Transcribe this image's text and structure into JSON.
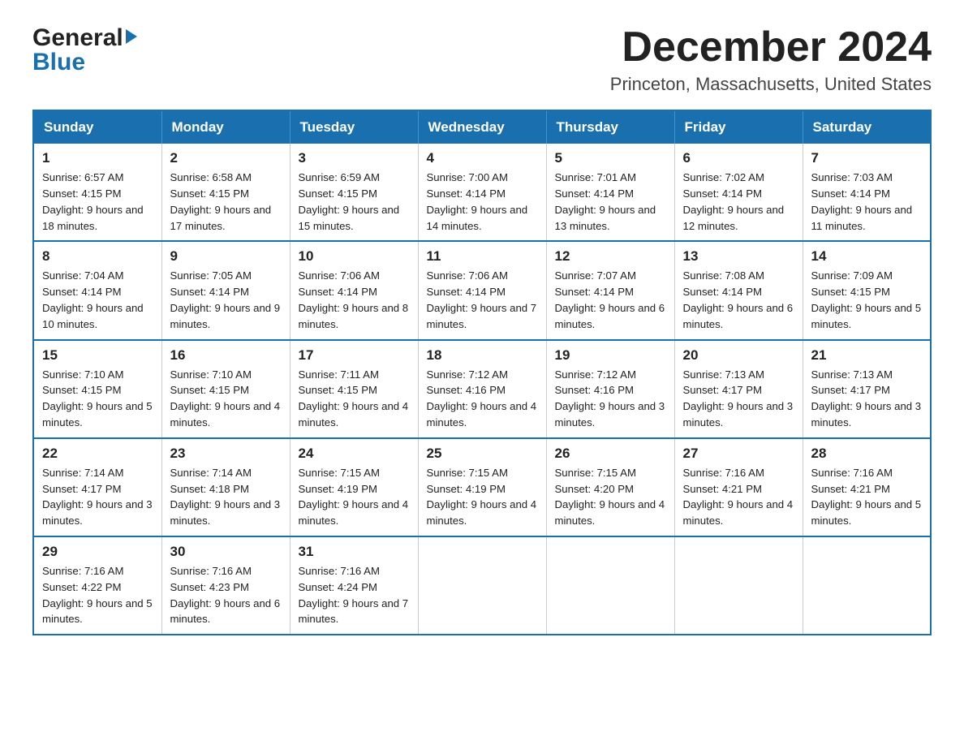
{
  "header": {
    "logo_general": "General",
    "logo_blue": "Blue",
    "month_title": "December 2024",
    "location": "Princeton, Massachusetts, United States"
  },
  "days_of_week": [
    "Sunday",
    "Monday",
    "Tuesday",
    "Wednesday",
    "Thursday",
    "Friday",
    "Saturday"
  ],
  "weeks": [
    [
      {
        "day": "1",
        "sunrise": "6:57 AM",
        "sunset": "4:15 PM",
        "daylight": "9 hours and 18 minutes."
      },
      {
        "day": "2",
        "sunrise": "6:58 AM",
        "sunset": "4:15 PM",
        "daylight": "9 hours and 17 minutes."
      },
      {
        "day": "3",
        "sunrise": "6:59 AM",
        "sunset": "4:15 PM",
        "daylight": "9 hours and 15 minutes."
      },
      {
        "day": "4",
        "sunrise": "7:00 AM",
        "sunset": "4:14 PM",
        "daylight": "9 hours and 14 minutes."
      },
      {
        "day": "5",
        "sunrise": "7:01 AM",
        "sunset": "4:14 PM",
        "daylight": "9 hours and 13 minutes."
      },
      {
        "day": "6",
        "sunrise": "7:02 AM",
        "sunset": "4:14 PM",
        "daylight": "9 hours and 12 minutes."
      },
      {
        "day": "7",
        "sunrise": "7:03 AM",
        "sunset": "4:14 PM",
        "daylight": "9 hours and 11 minutes."
      }
    ],
    [
      {
        "day": "8",
        "sunrise": "7:04 AM",
        "sunset": "4:14 PM",
        "daylight": "9 hours and 10 minutes."
      },
      {
        "day": "9",
        "sunrise": "7:05 AM",
        "sunset": "4:14 PM",
        "daylight": "9 hours and 9 minutes."
      },
      {
        "day": "10",
        "sunrise": "7:06 AM",
        "sunset": "4:14 PM",
        "daylight": "9 hours and 8 minutes."
      },
      {
        "day": "11",
        "sunrise": "7:06 AM",
        "sunset": "4:14 PM",
        "daylight": "9 hours and 7 minutes."
      },
      {
        "day": "12",
        "sunrise": "7:07 AM",
        "sunset": "4:14 PM",
        "daylight": "9 hours and 6 minutes."
      },
      {
        "day": "13",
        "sunrise": "7:08 AM",
        "sunset": "4:14 PM",
        "daylight": "9 hours and 6 minutes."
      },
      {
        "day": "14",
        "sunrise": "7:09 AM",
        "sunset": "4:15 PM",
        "daylight": "9 hours and 5 minutes."
      }
    ],
    [
      {
        "day": "15",
        "sunrise": "7:10 AM",
        "sunset": "4:15 PM",
        "daylight": "9 hours and 5 minutes."
      },
      {
        "day": "16",
        "sunrise": "7:10 AM",
        "sunset": "4:15 PM",
        "daylight": "9 hours and 4 minutes."
      },
      {
        "day": "17",
        "sunrise": "7:11 AM",
        "sunset": "4:15 PM",
        "daylight": "9 hours and 4 minutes."
      },
      {
        "day": "18",
        "sunrise": "7:12 AM",
        "sunset": "4:16 PM",
        "daylight": "9 hours and 4 minutes."
      },
      {
        "day": "19",
        "sunrise": "7:12 AM",
        "sunset": "4:16 PM",
        "daylight": "9 hours and 3 minutes."
      },
      {
        "day": "20",
        "sunrise": "7:13 AM",
        "sunset": "4:17 PM",
        "daylight": "9 hours and 3 minutes."
      },
      {
        "day": "21",
        "sunrise": "7:13 AM",
        "sunset": "4:17 PM",
        "daylight": "9 hours and 3 minutes."
      }
    ],
    [
      {
        "day": "22",
        "sunrise": "7:14 AM",
        "sunset": "4:17 PM",
        "daylight": "9 hours and 3 minutes."
      },
      {
        "day": "23",
        "sunrise": "7:14 AM",
        "sunset": "4:18 PM",
        "daylight": "9 hours and 3 minutes."
      },
      {
        "day": "24",
        "sunrise": "7:15 AM",
        "sunset": "4:19 PM",
        "daylight": "9 hours and 4 minutes."
      },
      {
        "day": "25",
        "sunrise": "7:15 AM",
        "sunset": "4:19 PM",
        "daylight": "9 hours and 4 minutes."
      },
      {
        "day": "26",
        "sunrise": "7:15 AM",
        "sunset": "4:20 PM",
        "daylight": "9 hours and 4 minutes."
      },
      {
        "day": "27",
        "sunrise": "7:16 AM",
        "sunset": "4:21 PM",
        "daylight": "9 hours and 4 minutes."
      },
      {
        "day": "28",
        "sunrise": "7:16 AM",
        "sunset": "4:21 PM",
        "daylight": "9 hours and 5 minutes."
      }
    ],
    [
      {
        "day": "29",
        "sunrise": "7:16 AM",
        "sunset": "4:22 PM",
        "daylight": "9 hours and 5 minutes."
      },
      {
        "day": "30",
        "sunrise": "7:16 AM",
        "sunset": "4:23 PM",
        "daylight": "9 hours and 6 minutes."
      },
      {
        "day": "31",
        "sunrise": "7:16 AM",
        "sunset": "4:24 PM",
        "daylight": "9 hours and 7 minutes."
      },
      null,
      null,
      null,
      null
    ]
  ],
  "labels": {
    "sunrise_prefix": "Sunrise: ",
    "sunset_prefix": "Sunset: ",
    "daylight_prefix": "Daylight: "
  }
}
